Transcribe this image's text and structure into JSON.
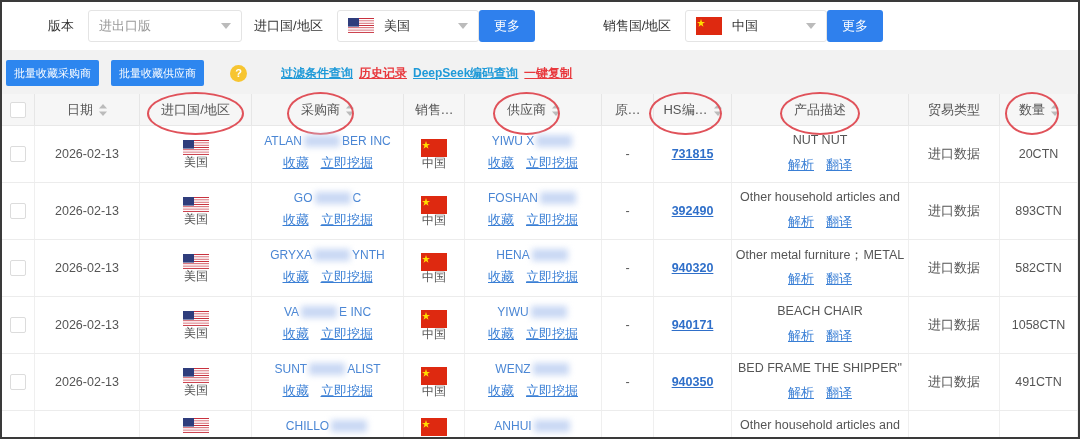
{
  "filters": [
    {
      "label": "版本",
      "placeholder": "进出口版"
    },
    {
      "label": "进口国/地区",
      "kind": "us",
      "value": "美国",
      "more": "更多"
    },
    {
      "label": "销售国/地区",
      "kind": "cn",
      "value": "中国",
      "more": "更多"
    }
  ],
  "toolbar": {
    "buttons": [
      "批量收藏采购商",
      "批量收藏供应商"
    ],
    "help": "?",
    "links": [
      {
        "text": "过滤条件查询",
        "color": "#1f9ad8"
      },
      {
        "text": "历史记录",
        "color": "#e8383d"
      },
      {
        "text": "DeepSeek编码查询",
        "color": "#1f9ad8"
      },
      {
        "text": "一键复制",
        "color": "#e8383d"
      }
    ]
  },
  "table": {
    "header_checked": false,
    "columns": [
      {
        "title": "日期",
        "sortable": true,
        "circled": false
      },
      {
        "title": "进口国/地区",
        "sortable": false,
        "circled": true
      },
      {
        "title": "采购商",
        "sortable": true,
        "circled": true
      },
      {
        "title": "销售…",
        "sortable": false,
        "circled": false
      },
      {
        "title": "供应商",
        "sortable": true,
        "circled": true
      },
      {
        "title": "原…",
        "sortable": false,
        "circled": false
      },
      {
        "title": "HS编…",
        "sortable": true,
        "circled": true
      },
      {
        "title": "产品描述",
        "sortable": false,
        "circled": true
      },
      {
        "title": "贸易类型",
        "sortable": false,
        "circled": false
      },
      {
        "title": "数量",
        "sortable": true,
        "circled": true
      }
    ],
    "rows": [
      {
        "checked": false,
        "date": "2026-02-13",
        "import_country": {
          "kind": "us",
          "name": "美国"
        },
        "buyer": [
          "ATLAN",
          "BER INC"
        ],
        "buyer_actions": [
          "收藏",
          "立即挖掘"
        ],
        "sales_country": {
          "kind": "cn",
          "name": "中国"
        },
        "supplier": [
          "YIWU X"
        ],
        "supplier_actions": [
          "收藏",
          "立即挖掘"
        ],
        "origin": "-",
        "hs": "731815",
        "description": "NUT NUT",
        "description_actions": [
          "解析",
          "翻译"
        ],
        "trade_type": "进口数据",
        "quantity": "20CTN"
      },
      {
        "checked": false,
        "date": "2026-02-13",
        "import_country": {
          "kind": "us",
          "name": "美国"
        },
        "buyer": [
          "GO",
          "C"
        ],
        "buyer_actions": [
          "收藏",
          "立即挖掘"
        ],
        "sales_country": {
          "kind": "cn",
          "name": "中国"
        },
        "supplier": [
          "FOSHAN"
        ],
        "supplier_actions": [
          "收藏",
          "立即挖掘"
        ],
        "origin": "-",
        "hs": "392490",
        "description": "Other household articles and",
        "description_actions": [
          "解析",
          "翻译"
        ],
        "trade_type": "进口数据",
        "quantity": "893CTN"
      },
      {
        "checked": false,
        "date": "2026-02-13",
        "import_country": {
          "kind": "us",
          "name": "美国"
        },
        "buyer": [
          "GRYXA",
          "YNTH"
        ],
        "buyer_actions": [
          "收藏",
          "立即挖掘"
        ],
        "sales_country": {
          "kind": "cn",
          "name": "中国"
        },
        "supplier": [
          "HENA"
        ],
        "supplier_actions": [
          "收藏",
          "立即挖掘"
        ],
        "origin": "-",
        "hs": "940320",
        "description": "Other metal furniture；METAL",
        "description_actions": [
          "解析",
          "翻译"
        ],
        "trade_type": "进口数据",
        "quantity": "582CTN"
      },
      {
        "checked": false,
        "date": "2026-02-13",
        "import_country": {
          "kind": "us",
          "name": "美国"
        },
        "buyer": [
          "VA",
          "E INC"
        ],
        "buyer_actions": [
          "收藏",
          "立即挖掘"
        ],
        "sales_country": {
          "kind": "cn",
          "name": "中国"
        },
        "supplier": [
          "YIWU"
        ],
        "supplier_actions": [
          "收藏",
          "立即挖掘"
        ],
        "origin": "-",
        "hs": "940171",
        "description": "BEACH CHAIR",
        "description_actions": [
          "解析",
          "翻译"
        ],
        "trade_type": "进口数据",
        "quantity": "1058CTN"
      },
      {
        "checked": false,
        "date": "2026-02-13",
        "import_country": {
          "kind": "us",
          "name": "美国"
        },
        "buyer": [
          "SUNT",
          "ALIST"
        ],
        "buyer_actions": [
          "收藏",
          "立即挖掘"
        ],
        "sales_country": {
          "kind": "cn",
          "name": "中国"
        },
        "supplier": [
          "WENZ"
        ],
        "supplier_actions": [
          "收藏",
          "立即挖掘"
        ],
        "origin": "-",
        "hs": "940350",
        "description": "BED FRAME THE SHIPPER\"",
        "description_actions": [
          "解析",
          "翻译"
        ],
        "trade_type": "进口数据",
        "quantity": "491CTN"
      },
      {
        "import_country": {
          "kind": "us"
        },
        "buyer": [
          "CHILLO"
        ],
        "sales_country": {
          "kind": "cn"
        },
        "supplier": [
          "ANHUI"
        ],
        "description": "Other household articles and"
      }
    ]
  }
}
